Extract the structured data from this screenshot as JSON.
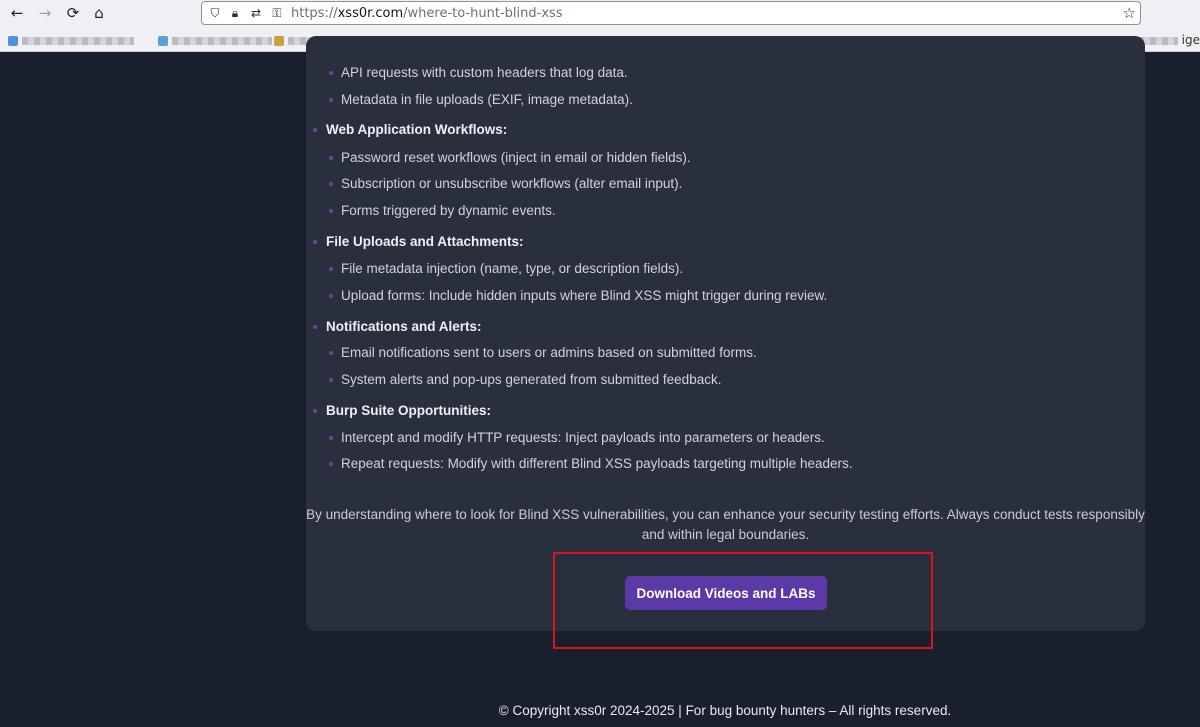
{
  "browser": {
    "url_scheme": "https://",
    "url_host": "xss0r.com",
    "url_path": "/where-to-hunt-blind-xss",
    "bookmark_overflow_text": "ige"
  },
  "sections": [
    {
      "title": "",
      "items": [
        "API requests with custom headers that log data.",
        "Metadata in file uploads (EXIF, image metadata)."
      ]
    },
    {
      "title": "Web Application Workflows:",
      "items": [
        "Password reset workflows (inject in email or hidden fields).",
        "Subscription or unsubscribe workflows (alter email input).",
        "Forms triggered by dynamic events."
      ]
    },
    {
      "title": "File Uploads and Attachments:",
      "items": [
        "File metadata injection (name, type, or description fields).",
        "Upload forms: Include hidden inputs where Blind XSS might trigger during review."
      ]
    },
    {
      "title": "Notifications and Alerts:",
      "items": [
        "Email notifications sent to users or admins based on submitted forms.",
        "System alerts and pop-ups generated from submitted feedback."
      ]
    },
    {
      "title": "Burp Suite Opportunities:",
      "items": [
        "Intercept and modify HTTP requests: Inject payloads into parameters or headers.",
        "Repeat requests: Modify with different Blind XSS payloads targeting multiple headers."
      ]
    }
  ],
  "closing_paragraph_line1": "By understanding where to look for Blind XSS vulnerabilities, you can enhance your security testing efforts. Always conduct tests responsibly",
  "closing_paragraph_line2": "and within legal boundaries.",
  "download_button_label": "Download Videos and LABs",
  "footer_text": "© Copyright xss0r 2024-2025 | For bug bounty hunters – All rights reserved.",
  "colors": {
    "page_bg": "#1a1f2e",
    "card_bg": "#2a2f3e",
    "accent": "#5b3aa8",
    "bullet": "#5c4b9e",
    "highlight_box": "#d6161b"
  }
}
